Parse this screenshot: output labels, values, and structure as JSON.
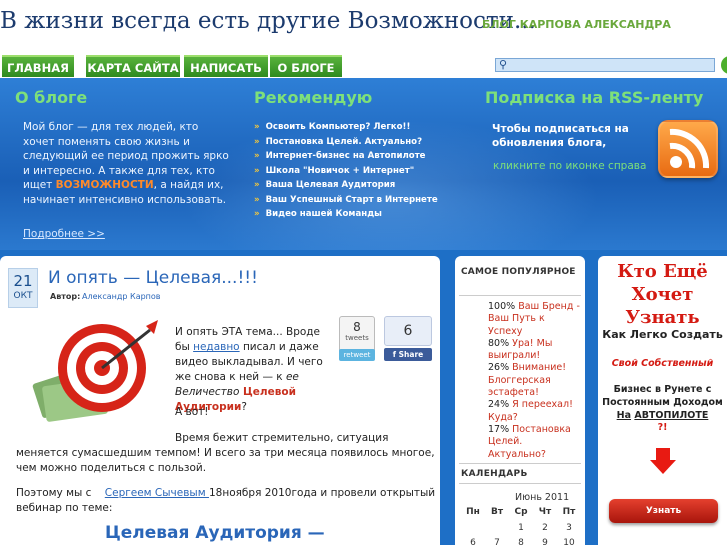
{
  "header": {
    "site_title": "В жизни всегда есть другие Возможности...",
    "blog_author": "БЛОГ КАРПОВА АЛЕКСАНДРА"
  },
  "nav": {
    "items": [
      "ГЛАВНАЯ",
      "КАРТА САЙТА",
      "НАПИСАТЬ",
      "О БЛОГЕ"
    ],
    "search_value": ""
  },
  "band": {
    "about": {
      "title": "О блоге",
      "text_1": "Мой блог — для тех людей, кто хочет поменять свою жизнь и следующий ее период прожить ярко и интересно.",
      "text_2": "А также для тех, кто ищет",
      "highlight": "ВОЗМОЖНОСТИ",
      "text_3": ", а найдя их, начинает интенсивно использовать.",
      "more_link": "Подробнее >>"
    },
    "recommend": {
      "title": "Рекомендую",
      "items": [
        "Освоить Компьютер? Легко!!",
        "Постановка Целей. Актуально?",
        "Интернет-бизнес на Автопилоте",
        "Школа \"Новичок + Интернет\"",
        "Ваша Целевая Аудитория",
        "Ваш Успешный Старт в Интернете",
        "Видео нашей Команды"
      ]
    },
    "rss": {
      "title": "Подписка на RSS-ленту",
      "text": "Чтобы подписаться на обновления блога,",
      "hint": "кликните по иконке справа"
    }
  },
  "post": {
    "day": "21",
    "month": "ОКТ",
    "title": "И опять — Целевая...!!!",
    "author_label": "Автор:",
    "author": "Александр Карпов",
    "tweets_count": "8",
    "tweets_label": "tweets",
    "retweet_label": "retweet",
    "fb_count": "6",
    "fb_label": "f  Share",
    "p1_a": "И опять ЭТА тема... Вроде бы ",
    "p1_link": "недавно",
    "p1_b": " писал и даже видео выкладывал. И чего же снова к ней — к ",
    "p1_it": "ее Величество",
    "p1_red": " Целевой Аудитории",
    "p1_end": "?",
    "p2": "А вот!",
    "p3": "Время бежит стремительно, ситуация меняется сумасшедшим темпом! И всего за три месяца появилось многое, чем можно поделиться с пользой.",
    "p4_a": "Поэтому мы с ",
    "p4_link": "Сергеем Сычевым ",
    "p4_b": " 18ноября  2010года и провели открытый вебинар по теме:",
    "subtitle": "Целевая Аудитория —"
  },
  "popular": {
    "title": "САМОЕ ПОПУЛЯРНОЕ",
    "items": [
      {
        "pct": "100%",
        "title": "Ваш Бренд - Ваш Путь к Успеху"
      },
      {
        "pct": "80%",
        "title": "Ура! Мы выиграли!"
      },
      {
        "pct": "26%",
        "title": "Внимание! Блоггерская эстафета!"
      },
      {
        "pct": "24%",
        "title": "Я переехал! Куда?"
      },
      {
        "pct": "17%",
        "title": "Постановка Целей. Актуально?"
      }
    ]
  },
  "calendar": {
    "title": "КАЛЕНДАРЬ",
    "month": "Июнь 2011",
    "weekdays": [
      "Пн",
      "Вт",
      "Ср",
      "Чт",
      "Пт"
    ],
    "rows": [
      [
        "",
        "",
        "1",
        "2",
        "3"
      ],
      [
        "6",
        "7",
        "8",
        "9",
        "10"
      ]
    ]
  },
  "promo": {
    "line1": "Кто Ещё Хочет Узнать",
    "line2": "Как Легко Создать",
    "line3": "Свой Собственный",
    "line4a": "Бизнес в Рунете с Постоянным Доходом",
    "line4b": "На",
    "line4c": "АВТОПИЛОТЕ",
    "line5": "?!",
    "button": "Узнать подробности!"
  },
  "colors": {
    "accent_blue": "#1e6fc6",
    "nav_green": "#3a9a26",
    "title_red": "#d41a12",
    "band_heading_green": "#7ee07a"
  }
}
